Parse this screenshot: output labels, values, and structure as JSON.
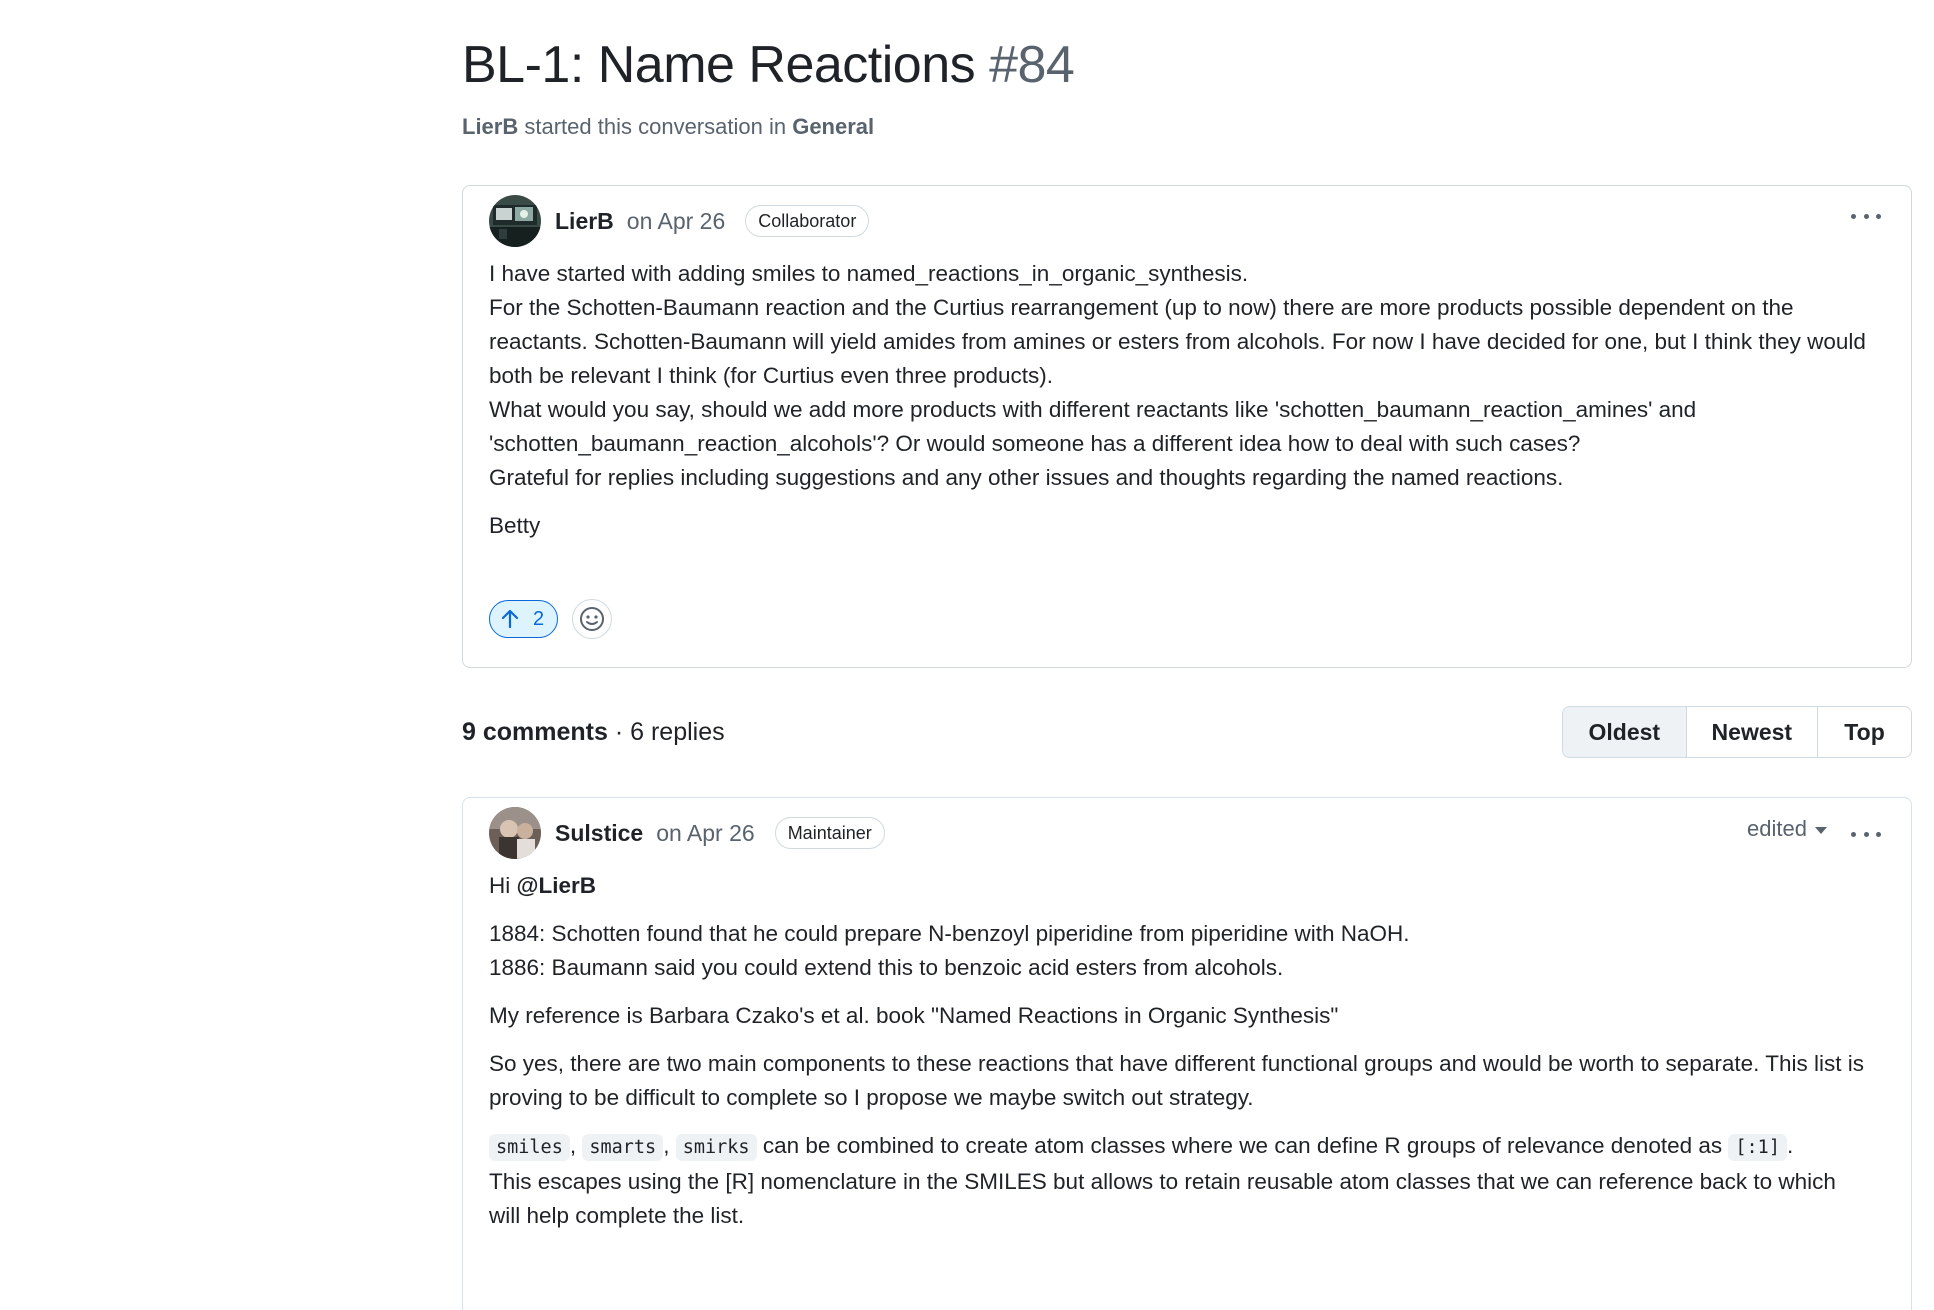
{
  "discussion": {
    "title": "BL-1: Name Reactions",
    "number": "#84",
    "starter": "LierB",
    "started_text": "started this conversation in",
    "category": "General"
  },
  "post": {
    "author": "LierB",
    "date": "on Apr 26",
    "role": "Collaborator",
    "paragraphs": [
      "I have started with adding smiles to named_reactions_in_organic_synthesis.",
      "For the Schotten-Baumann reaction and the Curtius rearrangement (up to now) there are more products possible dependent on the reactants. Schotten-Baumann will yield amides from amines or esters from alcohols. For now I have decided for one, but I think they would both be relevant I think (for Curtius even three products).",
      "What would you say, should we add more products with different reactants like 'schotten_baumann_reaction_amines' and 'schotten_baumann_reaction_alcohols'? Or would someone has a different idea how to deal with such cases?",
      "Grateful for replies including suggestions and any other issues and thoughts regarding the named reactions."
    ],
    "signature": "Betty",
    "upvote_count": "2",
    "icons": {
      "upvote": "arrow-up-icon",
      "reaction": "smiley-icon",
      "menu": "kebab-horizontal-icon"
    }
  },
  "comments_summary": {
    "comments": "9 comments",
    "separator": "·",
    "replies": "6 replies"
  },
  "sort": {
    "options": [
      "Oldest",
      "Newest",
      "Top"
    ],
    "active": "Oldest"
  },
  "comment1": {
    "author": "Sulstice",
    "date": "on Apr 26",
    "role": "Maintainer",
    "edited_label": "edited",
    "greeting": "Hi",
    "mention": "@LierB",
    "history_1": "1884: Schotten found that he could prepare N-benzoyl piperidine from piperidine with NaOH.",
    "history_2": "1886: Baumann said you could extend this to benzoic acid esters from alcohols.",
    "reference": "My reference is Barbara Czako's et al. book \"Named Reactions in Organic Synthesis\"",
    "proposal": "So yes, there are two main components to these reactions that have different functional groups and would be worth to separate. This list is proving to be difficult to complete so I propose we maybe switch out strategy.",
    "code_1": "smiles",
    "comma": ",",
    "code_2": "smarts",
    "code_3": "smirks",
    "atom_text": "can be combined to create atom classes where we can define R groups of relevance denoted as",
    "code_4": "[:1]",
    "period": ".",
    "atom_text_2": "This escapes using the [R] nomenclature in the SMILES but allows to retain reusable atom classes that we can reference back to which will help complete the list."
  },
  "colors": {
    "text": "#1f2328",
    "muted": "#59636e",
    "border": "#d1d9e0",
    "accent": "#0969da",
    "accent_bg": "#ddf4ff"
  }
}
